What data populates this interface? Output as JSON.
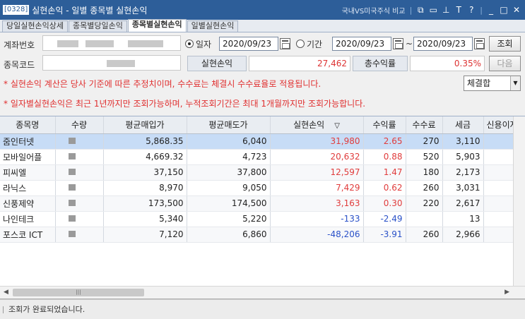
{
  "window": {
    "screen_no": "[0328]",
    "title": "실현손익 - 일별 종목별 실현손익",
    "compare_link": "국내VS미국주식 비교",
    "icons": [
      "restore-icon",
      "window-icon",
      "pin-icon",
      "font-icon",
      "help-icon",
      "minimize-icon",
      "maximize-icon",
      "close-icon"
    ]
  },
  "tabs": [
    {
      "label": "당일실현손익상세"
    },
    {
      "label": "종목별당일손익"
    },
    {
      "label": "종목별실현손익"
    },
    {
      "label": "일별실현손익"
    }
  ],
  "form": {
    "account_label": "계좌번호",
    "stock_code_label": "종목코드",
    "radio_daily": "일자",
    "radio_period": "기간",
    "date_daily": "2020/09/23",
    "date_from": "2020/09/23",
    "date_sep": "~",
    "date_to": "2020/09/23",
    "query_button": "조회",
    "next_button": "다음",
    "realized_pl_label": "실현손익",
    "realized_pl_value": "27,462",
    "total_return_label": "총수익률",
    "total_return_value": "0.35%",
    "notice_1": "* 실현손익 계산은 당사 기준에 따른 추정치이며, 수수료는 체결시 수수료율로 적용됩니다.",
    "notice_2": "* 일자별실현손익은 최근 1년까지만 조회가능하며, 누적조회기간은 최대 1개월까지만 조회가능합니다.",
    "basis_select": "체결합"
  },
  "table": {
    "columns": [
      "종목명",
      "수량",
      "평균매입가",
      "평균매도가",
      "실현손익",
      "수익률",
      "수수료",
      "세금",
      "신용이자"
    ],
    "rows": [
      {
        "name": "줌인터넷",
        "avg_buy": "5,868.35",
        "avg_sell": "6,040",
        "pl": "31,980",
        "rate": "2.65",
        "fee": "270",
        "tax": "3,110",
        "sign": "pos"
      },
      {
        "name": "모바일어플",
        "avg_buy": "4,669.32",
        "avg_sell": "4,723",
        "pl": "20,632",
        "rate": "0.88",
        "fee": "520",
        "tax": "5,903",
        "sign": "pos"
      },
      {
        "name": "피씨엘",
        "avg_buy": "37,150",
        "avg_sell": "37,800",
        "pl": "12,597",
        "rate": "1.47",
        "fee": "180",
        "tax": "2,173",
        "sign": "pos"
      },
      {
        "name": "라닉스",
        "avg_buy": "8,970",
        "avg_sell": "9,050",
        "pl": "7,429",
        "rate": "0.62",
        "fee": "260",
        "tax": "3,031",
        "sign": "pos"
      },
      {
        "name": "신풍제약",
        "avg_buy": "173,500",
        "avg_sell": "174,500",
        "pl": "3,163",
        "rate": "0.30",
        "fee": "220",
        "tax": "2,617",
        "sign": "pos"
      },
      {
        "name": "나인테크",
        "avg_buy": "5,340",
        "avg_sell": "5,220",
        "pl": "-133",
        "rate": "-2.49",
        "fee": "",
        "tax": "13",
        "sign": "neg"
      },
      {
        "name": "포스코 ICT",
        "avg_buy": "7,120",
        "avg_sell": "6,860",
        "pl": "-48,206",
        "rate": "-3.91",
        "fee": "260",
        "tax": "2,966",
        "sign": "neg"
      }
    ]
  },
  "status": {
    "message": "조회가 완료되었습니다."
  }
}
